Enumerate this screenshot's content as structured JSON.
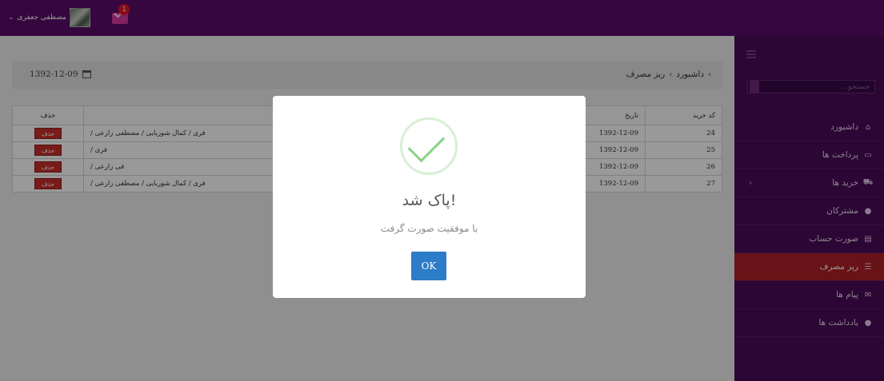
{
  "header": {
    "user_name": "مصطفی جعفری",
    "user_caret": "⌄",
    "mail_badge": "1"
  },
  "sidebar": {
    "search_placeholder": "جستجو...",
    "items": [
      {
        "label": "داشبورد",
        "icon": "home-icon",
        "glyph": "⌂"
      },
      {
        "label": "پرداخت ها",
        "icon": "credit-card-icon",
        "glyph": "▭"
      },
      {
        "label": "خرید ها",
        "icon": "cart-icon",
        "glyph": "⛟",
        "arrow": "‹"
      },
      {
        "label": "مشترکان",
        "icon": "user-icon",
        "glyph": "●"
      },
      {
        "label": "صورت حساب",
        "icon": "invoice-icon",
        "glyph": "▤"
      },
      {
        "label": "ریز مصرف",
        "icon": "list-icon",
        "glyph": "☰",
        "active": true
      },
      {
        "label": "پیام ها",
        "icon": "envelope-icon",
        "glyph": "✉"
      },
      {
        "label": "یادداشت ها",
        "icon": "comment-icon",
        "glyph": "●"
      }
    ]
  },
  "breadcrumb": {
    "items": [
      "داشبورد",
      "ریز مصرف"
    ],
    "sep": "›"
  },
  "date": "1392-12-09",
  "table": {
    "headers": {
      "id": "کد خرید",
      "date": "تاریخ",
      "members": "",
      "delete": "حذف"
    },
    "rows": [
      {
        "id": "24",
        "date": "1392-12-09",
        "members": "فری / کمال شوربایی / مصطفی زارعی /",
        "delete": "حذف"
      },
      {
        "id": "25",
        "date": "1392-12-09",
        "members": "فری /",
        "delete": "حذف"
      },
      {
        "id": "26",
        "date": "1392-12-09",
        "members": "فی زارعی /",
        "delete": "حذف"
      },
      {
        "id": "27",
        "date": "1392-12-09",
        "members": "فری / کمال شوربایی / مصطفی زارعی /",
        "delete": "حذف"
      }
    ]
  },
  "modal": {
    "title": "پاک شد!",
    "text": "با موفقیت صورت گرفت",
    "ok_label": "OK",
    "icon": "success-check-icon"
  },
  "colors": {
    "topbar": "#5a0c69",
    "sidebar": "#4a0b58",
    "active": "#b01e27",
    "danger": "#c9302c",
    "primary": "#2d7cc7",
    "success": "#8bd185"
  }
}
